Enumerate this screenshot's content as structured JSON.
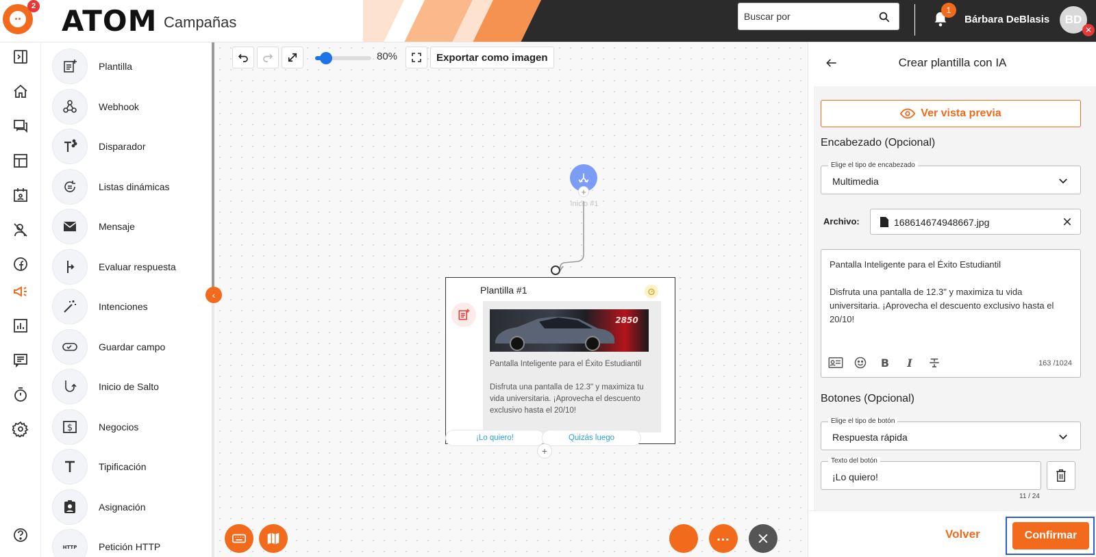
{
  "header": {
    "notification_count": "2",
    "brand": "ATOM",
    "module": "Campañas",
    "search_placeholder": "Buscar por",
    "bell_count": "1",
    "user_name": "Bárbara DeBlasis",
    "avatar_initials": "BD"
  },
  "rail": {
    "icons": [
      "expand-panel-icon",
      "home-icon",
      "chat-icon",
      "table-icon",
      "calendar-icon",
      "user-off-icon",
      "facebook-icon",
      "megaphone-icon",
      "chart-icon",
      "form-icon",
      "stopwatch-icon",
      "settings-icon",
      "help-icon"
    ],
    "active": "megaphone-icon"
  },
  "nodes": {
    "items": [
      {
        "label": "Plantilla",
        "icon": "template-add-icon"
      },
      {
        "label": "Webhook",
        "icon": "webhook-icon"
      },
      {
        "label": "Disparador",
        "icon": "trigger-icon"
      },
      {
        "label": "Listas dinámicas",
        "icon": "dynamic-list-icon"
      },
      {
        "label": "Mensaje",
        "icon": "mail-icon"
      },
      {
        "label": "Evaluar respuesta",
        "icon": "branch-icon"
      },
      {
        "label": "Intenciones",
        "icon": "magic-wand-icon"
      },
      {
        "label": "Guardar campo",
        "icon": "save-field-icon"
      },
      {
        "label": "Inicio de Salto",
        "icon": "jump-icon"
      },
      {
        "label": "Negocios",
        "icon": "dollar-icon"
      },
      {
        "label": "Tipificación",
        "icon": "text-t-icon"
      },
      {
        "label": "Asignación",
        "icon": "assign-icon"
      },
      {
        "label": "Petición HTTP",
        "icon": "http-icon"
      }
    ]
  },
  "toolbar": {
    "zoom_label": "80%",
    "zoom_value": 0.8,
    "export_label": "Exportar como imagen"
  },
  "canvas": {
    "start_label": "Inicio #1",
    "template_title": "Plantilla #1",
    "template_line1": "Pantalla Inteligente para el Éxito Estudiantil",
    "template_line2": "Disfruta una pantalla de 12.3\" y maximiza tu vida universitaria. ¡Aprovecha el descuento exclusivo hasta el 20/10!",
    "quick_reply_1": "¡Lo quiero!",
    "quick_reply_2": "Quizás luego",
    "image_text": "2850"
  },
  "panel": {
    "title": "Crear plantilla con IA",
    "preview_label": "Ver vista previa",
    "header_section": "Encabezado (Opcional)",
    "header_type_label": "Elige el tipo de encabezado",
    "header_type_value": "Multimedia",
    "file_label": "Archivo:",
    "file_name": "168614674948667.jpg",
    "body_line1": "Pantalla Inteligente para el Éxito Estudiantil",
    "body_line2": "Disfruta una pantalla de 12.3\" y maximiza tu vida universitaria. ¡Aprovecha el descuento exclusivo hasta el 20/10!",
    "body_counter": "163 /1024",
    "buttons_section": "Botones (Opcional)",
    "button_type_label": "Elige el tipo de botón",
    "button_type_value": "Respuesta rápida",
    "button_text_label": "Texto del botón",
    "button_text_value": "¡Lo quiero!",
    "button_text_counter": "11 / 24",
    "back_label": "Volver",
    "confirm_label": "Confirmar"
  },
  "colors": {
    "accent": "#f26a1b",
    "dark_header": "#2b2b2b",
    "link_blue": "#2aa0d9",
    "focus_blue": "#2a5bd7"
  }
}
